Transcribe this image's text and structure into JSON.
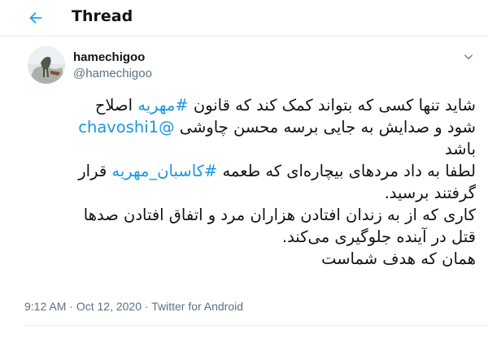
{
  "header": {
    "back_icon": "arrow-left-icon",
    "title": "Thread"
  },
  "tweet": {
    "display_name": "hamechigoo",
    "handle": "@hamechigoo",
    "more_icon": "chevron-down-icon",
    "lines": [
      {
        "parts": [
          {
            "t": "شاید تنها کسی که بتواند کمک کند که قانون "
          },
          {
            "t": "#مهریه",
            "link": true
          },
          {
            "t": " اصلاح"
          }
        ]
      },
      {
        "parts": [
          {
            "t": "شود و صدایش به جایی برسه محسن چاوشی "
          },
          {
            "t": "@chavoshi1",
            "link": true
          }
        ]
      },
      {
        "parts": [
          {
            "t": "باشد"
          }
        ]
      },
      {
        "parts": [
          {
            "t": "لطفا به داد مردهای بیچاره‌ای که طعمه "
          },
          {
            "t": "#کاسبان_مهریه",
            "link": true
          },
          {
            "t": " قرار"
          }
        ]
      },
      {
        "parts": [
          {
            "t": "گرفتند برسید."
          }
        ]
      },
      {
        "parts": [
          {
            "t": "کاری که از به زندان افتادن هزاران مرد و اتفاق افتادن صدها"
          }
        ]
      },
      {
        "parts": [
          {
            "t": "قتل در آینده جلوگیری می‌کند."
          }
        ]
      },
      {
        "parts": [
          {
            "t": "همان که هدف شماست"
          }
        ]
      }
    ],
    "time": "9:12 AM",
    "separator": " · ",
    "date": "Oct 12, 2020",
    "source": "Twitter for Android"
  },
  "colors": {
    "link": "#1b95e0",
    "secondary_text": "#5b7083",
    "accent": "#1da1f2"
  }
}
